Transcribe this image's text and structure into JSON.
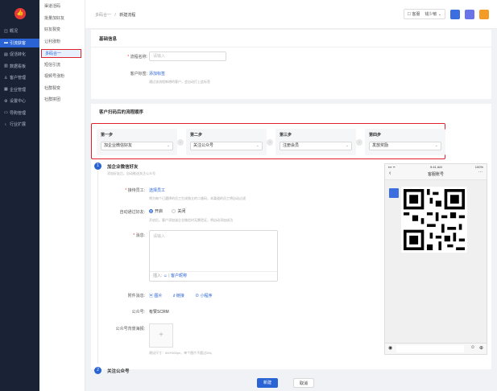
{
  "nav_primary": [
    {
      "icon": "home-icon",
      "glyph": "◫",
      "label": "概况",
      "active": false
    },
    {
      "icon": "customer-icon",
      "glyph": "▬",
      "label": "引流获客",
      "active": true
    },
    {
      "icon": "convert-icon",
      "glyph": "▤",
      "label": "促活转化",
      "active": false
    },
    {
      "icon": "chart-icon",
      "glyph": "▥",
      "label": "数据看板",
      "active": false
    },
    {
      "icon": "user-icon",
      "glyph": "♙",
      "label": "客户管理",
      "active": false
    },
    {
      "icon": "org-icon",
      "glyph": "▦",
      "label": "企业管理",
      "active": false
    },
    {
      "icon": "settings-icon",
      "glyph": "⚙",
      "label": "设置中心",
      "active": false
    },
    {
      "icon": "video-icon",
      "glyph": "▭",
      "label": "导购管理",
      "active": false
    },
    {
      "icon": "extend-icon",
      "glyph": "♁",
      "label": "行业扩展",
      "active": false
    }
  ],
  "nav_secondary": [
    {
      "label": "渠道活码",
      "active": false
    },
    {
      "label": "批量加好友",
      "active": false
    },
    {
      "label": "好友裂变",
      "active": false
    },
    {
      "label": "让利涨粉",
      "active": false
    },
    {
      "label": "多码合一",
      "active": true
    },
    {
      "label": "短信引流",
      "active": false
    },
    {
      "label": "视频号涨粉",
      "active": false
    },
    {
      "label": "社群裂变",
      "active": false
    },
    {
      "label": "社群拼团",
      "active": false
    }
  ],
  "breadcrumb": {
    "parent": "多码合一",
    "sep": "/",
    "current": "新建流程"
  },
  "topbar": {
    "service": "客服",
    "user": "钱少敏"
  },
  "basic": {
    "title": "基础信息",
    "name_label": "流程名称:",
    "name_placeholder": "请输入",
    "tag_label": "客户标签:",
    "tag_link": "添加标签",
    "tag_hint": "通过该流程新增的客户，会自动打上此标签"
  },
  "flow": {
    "title": "客户扫码后的流程顺序",
    "steps": [
      {
        "title": "第一步",
        "value": "加企业微信好友"
      },
      {
        "title": "第二步",
        "value": "关注公众号"
      },
      {
        "title": "第三步",
        "value": "注册会员"
      },
      {
        "title": "第四步",
        "value": "发放奖励"
      }
    ]
  },
  "section1": {
    "num": "1",
    "title": "加企业微信好友",
    "subtitle": "添加好友后，自动推送关注公众号",
    "staff_label": "接待员工:",
    "staff_link": "选择员工",
    "staff_hint": "将为每个已選择的员工生成独立的二维码，本渠道的员工将自动过滤",
    "auto_label": "自动通过好友:",
    "on_label": "开启",
    "off_label": "关闭",
    "auto_hint": "开启后，客户添加该企业微信时无需验证，将自动添加成功",
    "msg_label": "消息:",
    "msg_placeholder": "请输入",
    "insert_label": "插入:",
    "insert_link": "客户昵称",
    "attach_label": "附件消息:",
    "attach_image": "图片",
    "attach_link": "链接",
    "attach_mini": "小程序",
    "account_label": "公众号:",
    "account_value": "有赞SCRM",
    "bg_label": "公众号背景海报:",
    "bg_hint": "建议尺寸：640*600px，单个图片不超过2M。"
  },
  "section2": {
    "num": "2",
    "title": "关注公众号"
  },
  "phone": {
    "time": "9:41 AM",
    "battery": "100%",
    "title": "客服账号"
  },
  "buttons": {
    "save": "新建",
    "cancel": "取消"
  },
  "colors": {
    "primary": "#2a63d4",
    "sidebar": "#1a2236",
    "highlight": "#e0202a"
  }
}
